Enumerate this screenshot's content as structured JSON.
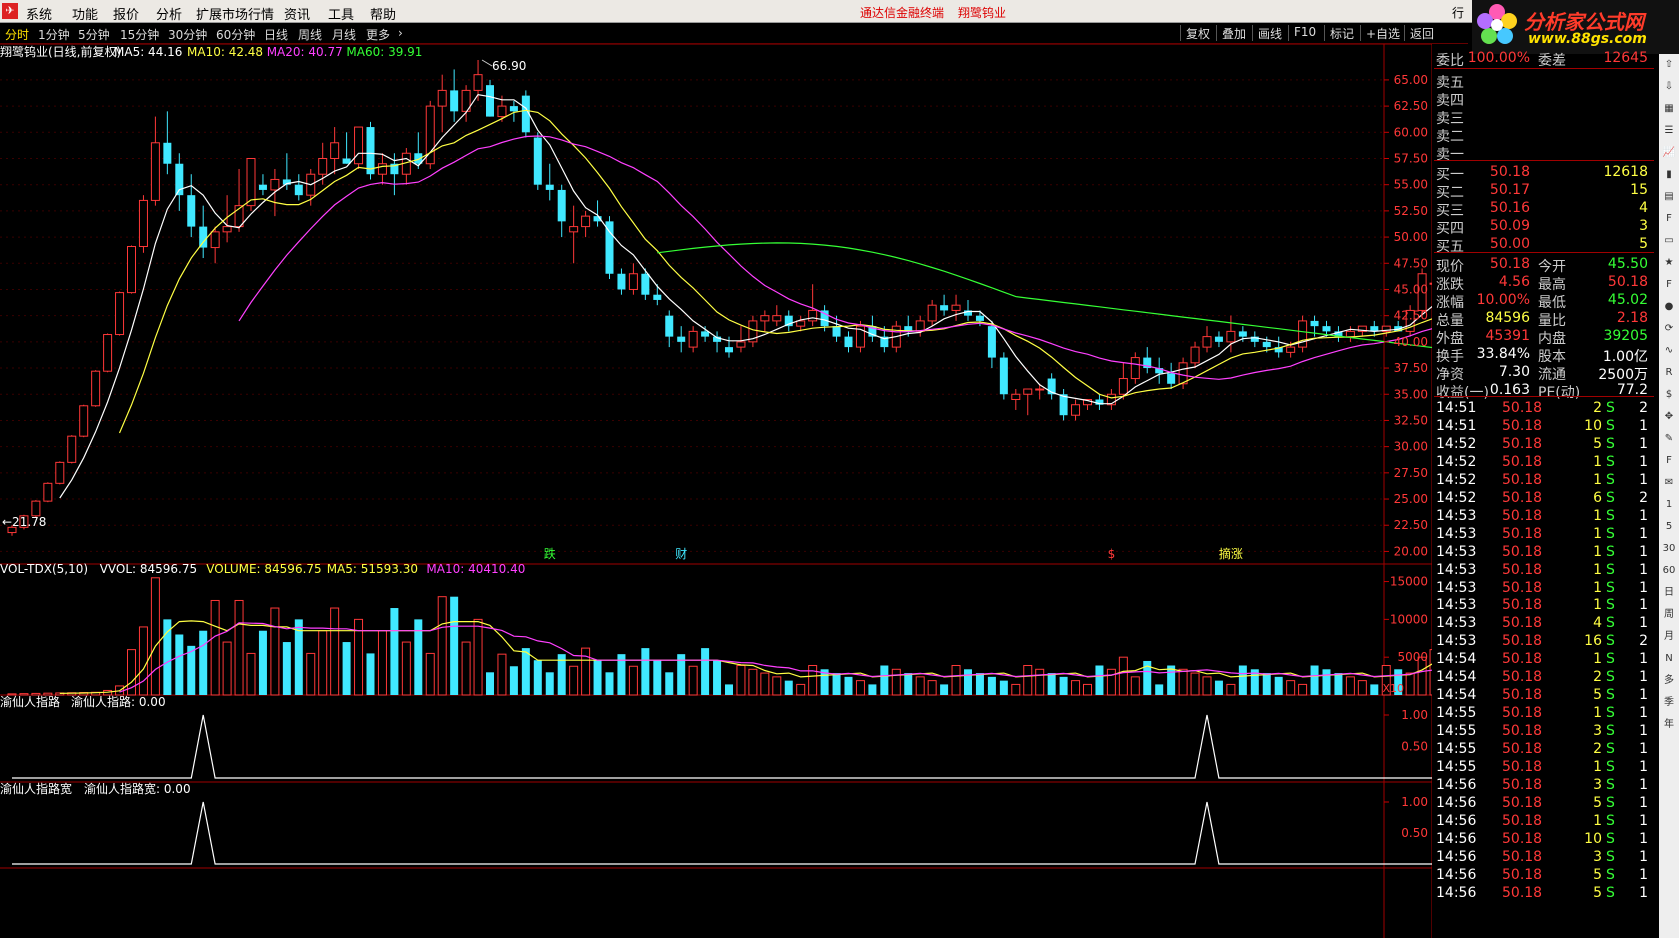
{
  "app": {
    "menu": [
      "系统",
      "功能",
      "报价",
      "分析",
      "扩展市场行情",
      "资讯",
      "工具",
      "帮助"
    ],
    "center_links": [
      "通达信金融终端",
      "翔鹭钨业"
    ],
    "brand_name": "分析家公式网",
    "brand_url": "www.88gs.com",
    "right_menu": "行"
  },
  "periods": {
    "items": [
      "分时",
      "1分钟",
      "5分钟",
      "15分钟",
      "30分钟",
      "60分钟",
      "日线",
      "周线",
      "月线",
      "更多"
    ],
    "active": "分时",
    "tools": [
      "复权",
      "叠加",
      "画线",
      "F10",
      "标记",
      "+自选",
      "返回"
    ]
  },
  "main_chart": {
    "title": "翔鹭钨业(日线,前复权)",
    "ma_labels": [
      {
        "text": "MA5: 44.16",
        "color": "#ffffff"
      },
      {
        "text": "MA10: 42.48",
        "color": "#ffff44"
      },
      {
        "text": "MA20: 40.77",
        "color": "#ff40ff"
      },
      {
        "text": "MA60: 39.91",
        "color": "#35ff35"
      }
    ],
    "price_ticks": [
      65,
      62.5,
      60,
      57.5,
      55,
      52.5,
      50,
      47.5,
      45,
      42.5,
      40,
      37.5,
      35,
      32.5,
      30,
      27.5,
      25,
      22.5,
      20
    ],
    "y_range": [
      18.8,
      66.9
    ],
    "high_label": "66.90",
    "low_label": "21.78",
    "markers": [
      {
        "text": "跌",
        "color": "#35ff35",
        "index": 45
      },
      {
        "text": "财",
        "color": "#40e8ff",
        "index": 56
      },
      {
        "text": "$",
        "color": "#ff3838",
        "index": 92
      },
      {
        "text": "摘涨",
        "color": "#ffff44",
        "index": 102
      }
    ],
    "candles": [
      [
        21.8,
        22.5,
        21.5,
        22.3
      ],
      [
        22.3,
        23.5,
        22.1,
        23.4
      ],
      [
        23.4,
        24.9,
        23.2,
        24.8
      ],
      [
        24.8,
        26.6,
        24.7,
        26.5
      ],
      [
        26.5,
        28.6,
        26.4,
        28.5
      ],
      [
        28.5,
        31.1,
        28.4,
        31.0
      ],
      [
        31.0,
        34.0,
        30.9,
        33.9
      ],
      [
        33.9,
        37.3,
        33.8,
        37.2
      ],
      [
        37.2,
        40.8,
        37.1,
        40.7
      ],
      [
        40.7,
        44.8,
        40.6,
        44.7
      ],
      [
        44.7,
        49.2,
        44.6,
        49.1
      ],
      [
        49.1,
        54.0,
        48.5,
        53.5
      ],
      [
        53.5,
        61.5,
        53.0,
        59.0
      ],
      [
        59.0,
        62.0,
        56.0,
        57.0
      ],
      [
        57.0,
        58.0,
        52.5,
        54.0
      ],
      [
        54.0,
        56.0,
        50.0,
        51.0
      ],
      [
        51.0,
        53.0,
        48.0,
        49.0
      ],
      [
        49.0,
        51.0,
        47.5,
        50.5
      ],
      [
        50.5,
        54.0,
        49.5,
        51.0
      ],
      [
        51.0,
        56.5,
        50.5,
        53.0
      ],
      [
        53.0,
        57.0,
        52.5,
        57.5
      ],
      [
        55.0,
        56.0,
        54.0,
        54.5
      ],
      [
        54.5,
        56.5,
        52.0,
        55.5
      ],
      [
        55.5,
        58.0,
        54.5,
        55.0
      ],
      [
        55.0,
        56.0,
        53.5,
        54.0
      ],
      [
        54.0,
        56.5,
        53.0,
        56.0
      ],
      [
        56.0,
        59.0,
        55.0,
        57.5
      ],
      [
        57.5,
        60.5,
        56.0,
        59.0
      ],
      [
        57.5,
        60.0,
        57.0,
        57.0
      ],
      [
        57.0,
        60.5,
        56.5,
        60.5
      ],
      [
        60.5,
        61.0,
        55.5,
        56.0
      ],
      [
        56.0,
        58.0,
        55.0,
        57.0
      ],
      [
        57.0,
        58.0,
        54.0,
        56.0
      ],
      [
        56.0,
        58.5,
        55.0,
        58.0
      ],
      [
        58.0,
        60.0,
        56.5,
        57.0
      ],
      [
        57.0,
        63.0,
        56.5,
        62.5
      ],
      [
        62.5,
        65.5,
        60.0,
        64.0
      ],
      [
        64.0,
        66.0,
        61.0,
        62.0
      ],
      [
        62.0,
        64.5,
        61.0,
        64.0
      ],
      [
        64.0,
        66.9,
        63.0,
        65.5
      ],
      [
        64.5,
        65.0,
        61.5,
        61.5
      ],
      [
        61.5,
        63.5,
        61.0,
        62.5
      ],
      [
        62.5,
        63.0,
        61.0,
        62.0
      ],
      [
        63.5,
        64.0,
        59.5,
        60.0
      ],
      [
        59.5,
        60.0,
        54.5,
        55.0
      ],
      [
        55.0,
        57.0,
        53.5,
        54.5
      ],
      [
        54.5,
        55.0,
        50.0,
        51.5
      ],
      [
        50.5,
        53.0,
        47.5,
        51.0
      ],
      [
        51.0,
        52.5,
        50.0,
        52.0
      ],
      [
        52.0,
        53.5,
        51.0,
        51.5
      ],
      [
        51.5,
        52.0,
        46.0,
        46.5
      ],
      [
        46.5,
        47.0,
        44.5,
        45.0
      ],
      [
        45.0,
        47.5,
        44.5,
        46.5
      ],
      [
        46.5,
        47.0,
        44.0,
        44.5
      ],
      [
        44.5,
        45.5,
        43.5,
        44.0
      ],
      [
        42.5,
        43.0,
        39.5,
        40.5
      ],
      [
        40.5,
        41.5,
        39.0,
        40.0
      ],
      [
        39.5,
        41.5,
        39.0,
        41.0
      ],
      [
        41.0,
        41.5,
        40.0,
        40.5
      ],
      [
        40.5,
        41.0,
        39.0,
        40.0
      ],
      [
        39.5,
        40.5,
        38.5,
        39.0
      ],
      [
        39.5,
        41.5,
        39.0,
        40.0
      ],
      [
        40.0,
        42.5,
        39.5,
        42.0
      ],
      [
        42.0,
        43.0,
        41.0,
        42.5
      ],
      [
        42.0,
        43.5,
        41.5,
        42.5
      ],
      [
        42.5,
        43.0,
        41.0,
        41.5
      ],
      [
        41.5,
        42.5,
        41.0,
        42.0
      ],
      [
        42.0,
        45.5,
        41.5,
        43.0
      ],
      [
        43.0,
        43.5,
        41.0,
        41.5
      ],
      [
        41.5,
        42.5,
        40.0,
        40.5
      ],
      [
        40.5,
        41.0,
        39.0,
        39.5
      ],
      [
        39.5,
        42.0,
        39.0,
        41.5
      ],
      [
        41.5,
        42.5,
        40.0,
        40.5
      ],
      [
        40.5,
        41.5,
        39.0,
        39.5
      ],
      [
        39.5,
        42.0,
        39.0,
        41.5
      ],
      [
        41.5,
        42.5,
        40.5,
        41.0
      ],
      [
        41.0,
        42.5,
        40.5,
        42.0
      ],
      [
        42.0,
        44.0,
        41.5,
        43.5
      ],
      [
        43.5,
        44.5,
        42.5,
        43.0
      ],
      [
        43.0,
        44.5,
        42.0,
        43.5
      ],
      [
        43.0,
        44.0,
        42.0,
        42.5
      ],
      [
        42.5,
        43.0,
        41.5,
        42.0
      ],
      [
        41.5,
        42.0,
        37.5,
        38.5
      ],
      [
        38.5,
        39.0,
        34.5,
        35.0
      ],
      [
        34.5,
        35.5,
        33.5,
        35.0
      ],
      [
        35.0,
        35.5,
        33.0,
        35.5
      ],
      [
        35.5,
        36.0,
        34.5,
        35.5
      ],
      [
        36.5,
        37.0,
        34.5,
        35.0
      ],
      [
        35.0,
        35.5,
        32.5,
        33.0
      ],
      [
        33.0,
        34.5,
        32.5,
        34.0
      ],
      [
        34.0,
        34.5,
        33.5,
        34.5
      ],
      [
        34.5,
        35.0,
        33.5,
        34.0
      ],
      [
        34.0,
        35.5,
        33.5,
        35.0
      ],
      [
        35.0,
        38.0,
        34.5,
        36.5
      ],
      [
        36.5,
        39.0,
        36.0,
        38.5
      ],
      [
        38.5,
        39.5,
        37.0,
        37.5
      ],
      [
        37.5,
        38.5,
        36.0,
        37.0
      ],
      [
        37.0,
        38.0,
        35.5,
        36.0
      ],
      [
        36.0,
        38.5,
        35.5,
        38.0
      ],
      [
        38.0,
        40.0,
        37.5,
        39.5
      ],
      [
        39.5,
        41.5,
        39.0,
        40.5
      ],
      [
        40.5,
        41.0,
        39.5,
        40.0
      ],
      [
        40.0,
        42.5,
        39.0,
        41.0
      ],
      [
        41.0,
        41.5,
        40.0,
        40.5
      ],
      [
        40.5,
        41.0,
        39.5,
        40.0
      ],
      [
        40.0,
        40.5,
        39.0,
        39.5
      ],
      [
        39.5,
        40.5,
        38.5,
        39.0
      ],
      [
        39.0,
        40.0,
        38.5,
        39.5
      ],
      [
        39.5,
        42.5,
        39.0,
        42.0
      ],
      [
        42.0,
        42.5,
        40.5,
        41.5
      ],
      [
        41.5,
        42.0,
        40.5,
        41.0
      ],
      [
        41.0,
        41.5,
        40.0,
        40.5
      ],
      [
        40.5,
        41.5,
        40.0,
        41.0
      ],
      [
        41.0,
        41.5,
        40.5,
        41.5
      ],
      [
        41.5,
        42.0,
        40.5,
        41.0
      ],
      [
        41.0,
        41.5,
        40.5,
        41.5
      ],
      [
        41.5,
        42.0,
        41.0,
        41.0
      ],
      [
        41.0,
        43.5,
        40.5,
        43.0
      ],
      [
        43.0,
        47.0,
        42.5,
        46.5
      ],
      [
        45.5,
        46.0,
        45.0,
        45.6
      ],
      [
        45.6,
        50.2,
        45.5,
        50.18
      ]
    ]
  },
  "vol_panel": {
    "labels": [
      {
        "text": "VOL-TDX(5,10)",
        "color": "#ffffff"
      },
      {
        "text": "VVOL: 84596.75",
        "color": "#ffffff"
      },
      {
        "text": "VOLUME: 84596.75",
        "color": "#ffff44"
      },
      {
        "text": "MA5: 51593.30",
        "color": "#ffff44"
      },
      {
        "text": "MA10: 40410.40",
        "color": "#ff40ff"
      }
    ],
    "ticks": [
      15000,
      10000,
      5000
    ],
    "y_max": 16000,
    "unit": "X10"
  },
  "ind1": {
    "labels": [
      "渝仙人指路",
      "渝仙人指路: 0.00"
    ],
    "ticks": [
      "1.00",
      "0.50"
    ],
    "spikes": [
      16,
      100
    ]
  },
  "ind2": {
    "labels": [
      "渝仙人指路宽",
      "渝仙人指路宽: 0.00"
    ],
    "ticks": [
      "1.00",
      "0.50"
    ],
    "spikes": [
      16,
      100
    ]
  },
  "quote": {
    "weibi": {
      "label": "委比",
      "value": "100.00%",
      "label2": "委差",
      "value2": "12645"
    },
    "sells": [
      {
        "label": "卖五",
        "price": "",
        "vol": ""
      },
      {
        "label": "卖四",
        "price": "",
        "vol": ""
      },
      {
        "label": "卖三",
        "price": "",
        "vol": ""
      },
      {
        "label": "卖二",
        "price": "",
        "vol": ""
      },
      {
        "label": "卖一",
        "price": "",
        "vol": ""
      }
    ],
    "buys": [
      {
        "label": "买一",
        "price": "50.18",
        "vol": "12618"
      },
      {
        "label": "买二",
        "price": "50.17",
        "vol": "15"
      },
      {
        "label": "买三",
        "price": "50.16",
        "vol": "4"
      },
      {
        "label": "买四",
        "price": "50.09",
        "vol": "3"
      },
      {
        "label": "买五",
        "price": "50.00",
        "vol": "5"
      }
    ],
    "stats": [
      {
        "l1": "现价",
        "v1": "50.18",
        "c1": "up",
        "l2": "今开",
        "v2": "45.50",
        "c2": "dn"
      },
      {
        "l1": "涨跌",
        "v1": "4.56",
        "c1": "up",
        "l2": "最高",
        "v2": "50.18",
        "c2": "up"
      },
      {
        "l1": "涨幅",
        "v1": "10.00%",
        "c1": "up",
        "l2": "最低",
        "v2": "45.02",
        "c2": "dn"
      },
      {
        "l1": "总量",
        "v1": "84596",
        "c1": "yl",
        "l2": "量比",
        "v2": "2.18",
        "c2": "up"
      },
      {
        "l1": "外盘",
        "v1": "45391",
        "c1": "up",
        "l2": "内盘",
        "v2": "39205",
        "c2": "dn"
      },
      {
        "l1": "换手",
        "v1": "33.84%",
        "c1": "wh",
        "l2": "股本",
        "v2": "1.00亿",
        "c2": "wh"
      },
      {
        "l1": "净资",
        "v1": "7.30",
        "c1": "wh",
        "l2": "流通",
        "v2": "2500万",
        "c2": "wh"
      },
      {
        "l1": "收益(一)",
        "v1": "0.163",
        "c1": "wh",
        "l2": "PE(动)",
        "v2": "77.2",
        "c2": "wh"
      }
    ],
    "trades": [
      [
        "14:51",
        "50.18",
        "2",
        "S",
        "2"
      ],
      [
        "14:51",
        "50.18",
        "10",
        "S",
        "1"
      ],
      [
        "14:52",
        "50.18",
        "5",
        "S",
        "1"
      ],
      [
        "14:52",
        "50.18",
        "1",
        "S",
        "1"
      ],
      [
        "14:52",
        "50.18",
        "1",
        "S",
        "1"
      ],
      [
        "14:52",
        "50.18",
        "6",
        "S",
        "2"
      ],
      [
        "14:53",
        "50.18",
        "1",
        "S",
        "1"
      ],
      [
        "14:53",
        "50.18",
        "1",
        "S",
        "1"
      ],
      [
        "14:53",
        "50.18",
        "1",
        "S",
        "1"
      ],
      [
        "14:53",
        "50.18",
        "1",
        "S",
        "1"
      ],
      [
        "14:53",
        "50.18",
        "1",
        "S",
        "1"
      ],
      [
        "14:53",
        "50.18",
        "1",
        "S",
        "1"
      ],
      [
        "14:53",
        "50.18",
        "4",
        "S",
        "1"
      ],
      [
        "14:53",
        "50.18",
        "16",
        "S",
        "2"
      ],
      [
        "14:54",
        "50.18",
        "1",
        "S",
        "1"
      ],
      [
        "14:54",
        "50.18",
        "2",
        "S",
        "1"
      ],
      [
        "14:54",
        "50.18",
        "5",
        "S",
        "1"
      ],
      [
        "14:55",
        "50.18",
        "1",
        "S",
        "1"
      ],
      [
        "14:55",
        "50.18",
        "3",
        "S",
        "1"
      ],
      [
        "14:55",
        "50.18",
        "2",
        "S",
        "1"
      ],
      [
        "14:55",
        "50.18",
        "1",
        "S",
        "1"
      ],
      [
        "14:56",
        "50.18",
        "3",
        "S",
        "1"
      ],
      [
        "14:56",
        "50.18",
        "5",
        "S",
        "1"
      ],
      [
        "14:56",
        "50.18",
        "1",
        "S",
        "1"
      ],
      [
        "14:56",
        "50.18",
        "10",
        "S",
        "1"
      ],
      [
        "14:56",
        "50.18",
        "3",
        "S",
        "1"
      ],
      [
        "14:56",
        "50.18",
        "5",
        "S",
        "1"
      ],
      [
        "14:56",
        "50.18",
        "5",
        "S",
        "1"
      ]
    ]
  },
  "sidebar_icons": [
    "up-arrow-icon",
    "down-arrow-icon",
    "grid-icon",
    "list-icon",
    "chart-icon",
    "bar-icon",
    "book-icon",
    "f10-icon",
    "doc-icon",
    "star-icon",
    "f2-icon",
    "circle-icon",
    "sync-icon",
    "wave-icon",
    "rsi-icon",
    "dollar-icon",
    "move-icon",
    "pen-icon",
    "f5-icon",
    "mail-icon"
  ],
  "sidebar_labels": [
    "1",
    "5",
    "30",
    "60",
    "日",
    "周",
    "月",
    "N",
    "多",
    "季",
    "年"
  ]
}
